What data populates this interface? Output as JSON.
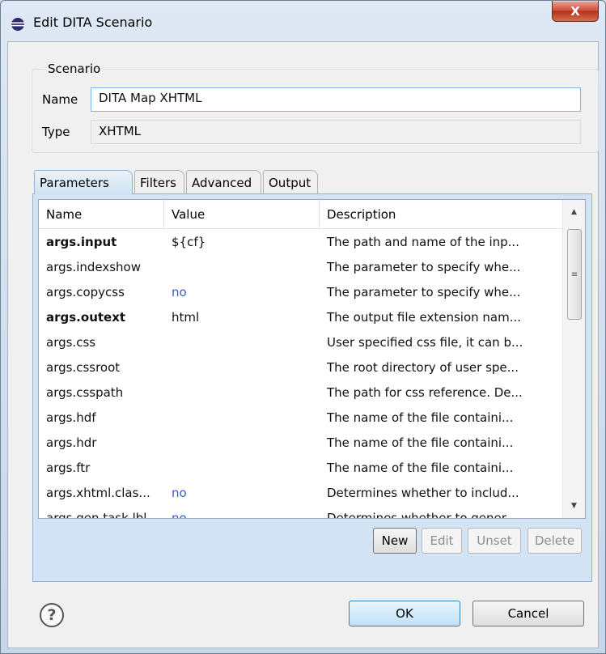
{
  "window": {
    "title": "Edit DITA Scenario",
    "close_label": "X"
  },
  "scenario": {
    "group_label": "Scenario",
    "name_label": "Name",
    "name_value": "DITA Map XHTML",
    "type_label": "Type",
    "type_value": "XHTML"
  },
  "tabs": [
    {
      "label": "Parameters"
    },
    {
      "label": "Filters"
    },
    {
      "label": "Advanced"
    },
    {
      "label": "Output"
    }
  ],
  "table": {
    "headers": [
      "Name",
      "Value",
      "Description"
    ],
    "rows": [
      {
        "name": "args.input",
        "value": "${cf}",
        "description": "The path and name of the inp...",
        "bold": true,
        "blue": false
      },
      {
        "name": "args.indexshow",
        "value": "",
        "description": "The parameter to specify whe...",
        "bold": false,
        "blue": false
      },
      {
        "name": "args.copycss",
        "value": "no",
        "description": "The parameter to specify whe...",
        "bold": false,
        "blue": true
      },
      {
        "name": "args.outext",
        "value": "html",
        "description": "The output file extension nam...",
        "bold": true,
        "blue": false
      },
      {
        "name": "args.css",
        "value": "",
        "description": "User specified css file, it can b...",
        "bold": false,
        "blue": false
      },
      {
        "name": "args.cssroot",
        "value": "",
        "description": "The root directory of user spe...",
        "bold": false,
        "blue": false
      },
      {
        "name": "args.csspath",
        "value": "",
        "description": "The path for css reference. De...",
        "bold": false,
        "blue": false
      },
      {
        "name": "args.hdf",
        "value": "",
        "description": "The name of the file containi...",
        "bold": false,
        "blue": false
      },
      {
        "name": "args.hdr",
        "value": "",
        "description": "The name of the file containi...",
        "bold": false,
        "blue": false
      },
      {
        "name": "args.ftr",
        "value": "",
        "description": "The name of the file containi...",
        "bold": false,
        "blue": false
      },
      {
        "name": "args.xhtml.clas...",
        "value": "no",
        "description": "Determines whether to includ...",
        "bold": false,
        "blue": true
      },
      {
        "name": "args.gen.task.lbl",
        "value": "no",
        "description": "Determines whether to gener...",
        "bold": false,
        "blue": true
      }
    ]
  },
  "table_buttons": {
    "new": "New",
    "edit": "Edit",
    "unset": "Unset",
    "delete": "Delete"
  },
  "footer": {
    "help_glyph": "?",
    "ok": "OK",
    "cancel": "Cancel"
  },
  "colors": {
    "accent_blue": "#3a57d6",
    "tab_active": "#cfe2f3"
  }
}
